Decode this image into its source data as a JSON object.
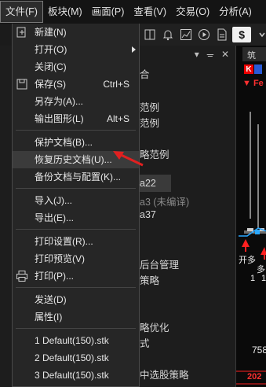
{
  "menubar": {
    "items": [
      "文件(F)",
      "板块(M)",
      "画面(P)",
      "查看(V)",
      "交易(O)",
      "分析(A)"
    ]
  },
  "toolbar": {
    "currency": "$"
  },
  "side_panel": {
    "items": [
      {
        "text": "合"
      },
      {
        "text": "范例"
      },
      {
        "text": "范例"
      },
      {
        "text": "略范例"
      },
      {
        "text": "a22"
      },
      {
        "text": "a3 (未编译)"
      },
      {
        "text": "a37"
      },
      {
        "text": "后台管理"
      },
      {
        "text": "策略"
      },
      {
        "text": "略优化"
      },
      {
        "text": "式"
      },
      {
        "text": "中选股策略"
      }
    ]
  },
  "chart": {
    "tab": "筑",
    "badge": "K",
    "top_text": "Fe",
    "labels": [
      {
        "text": "开多",
        "color": "white"
      },
      {
        "text": "1",
        "color": "white"
      },
      {
        "text": "多",
        "color": "white"
      },
      {
        "text": "1",
        "color": "white"
      },
      {
        "text": "758",
        "color": "white"
      },
      {
        "text": "202",
        "color": "red"
      }
    ]
  },
  "file_menu": {
    "items": [
      {
        "label": "新建(N)",
        "shortcut": "",
        "icon": "new-file-icon"
      },
      {
        "label": "打开(O)",
        "shortcut": "",
        "submenu": true
      },
      {
        "label": "关闭(C)",
        "shortcut": ""
      },
      {
        "label": "保存(S)",
        "shortcut": "Ctrl+S",
        "icon": "save-icon"
      },
      {
        "label": "另存为(A)...",
        "shortcut": ""
      },
      {
        "label": "输出图形(L)",
        "shortcut": "Alt+S"
      },
      {
        "label": "保护文档(B)...",
        "shortcut": ""
      },
      {
        "label": "恢复历史文档(U)...",
        "shortcut": "",
        "hover": true
      },
      {
        "label": "备份文档与配置(K)...",
        "shortcut": ""
      },
      {
        "label": "导入(J)...",
        "shortcut": ""
      },
      {
        "label": "导出(E)...",
        "shortcut": ""
      },
      {
        "label": "打印设置(R)...",
        "shortcut": ""
      },
      {
        "label": "打印预览(V)",
        "shortcut": ""
      },
      {
        "label": "打印(P)...",
        "shortcut": "",
        "icon": "printer-icon"
      },
      {
        "label": "发送(D)",
        "shortcut": ""
      },
      {
        "label": "属性(I)",
        "shortcut": ""
      },
      {
        "label": "1 Default(150).stk",
        "shortcut": ""
      },
      {
        "label": "2 Default(150).stk",
        "shortcut": ""
      },
      {
        "label": "3 Default(150).stk",
        "shortcut": ""
      }
    ]
  },
  "colors": {
    "accent_red": "#ff3030",
    "menu_bg": "#262626",
    "hover_bg": "#3b3b3b"
  }
}
